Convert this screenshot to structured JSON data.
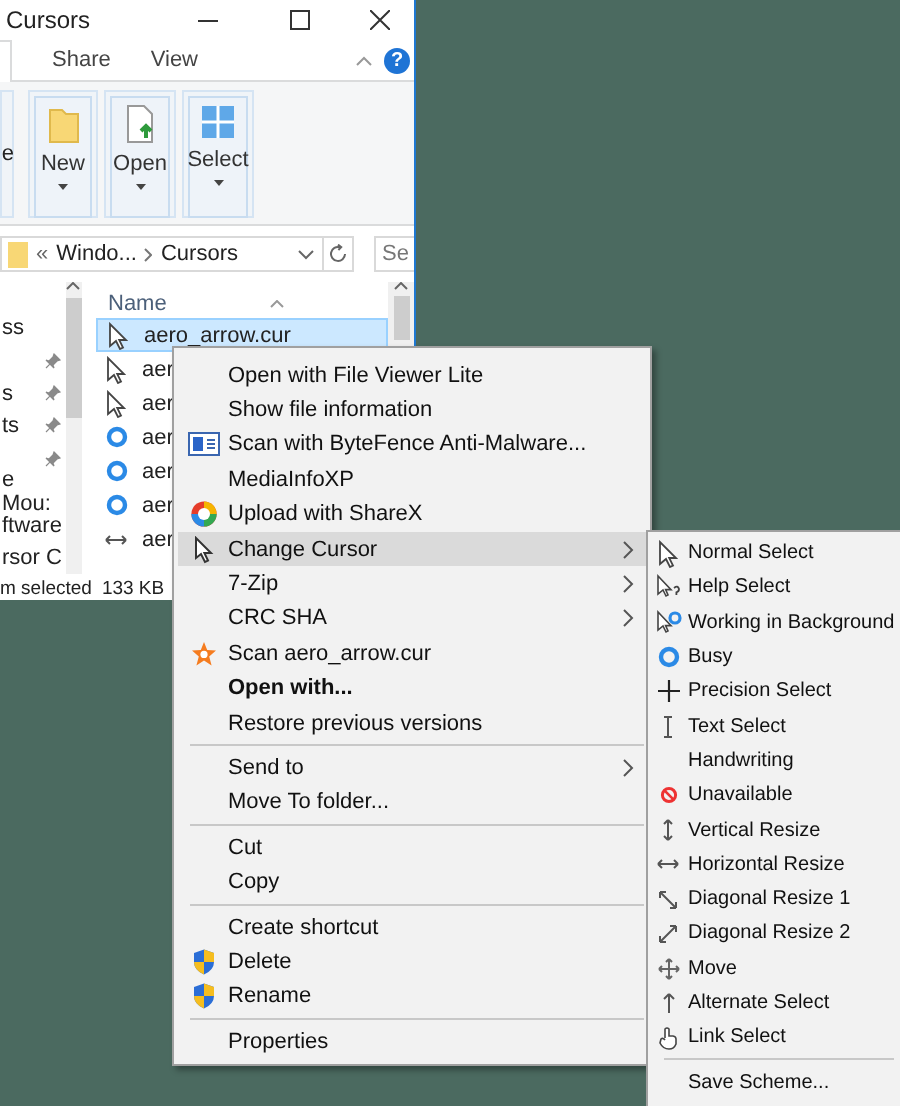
{
  "explorer": {
    "title": "Cursors",
    "ribbon_tabs": [
      "Share",
      "View"
    ],
    "help": "?",
    "ribbon_partial_label": "e",
    "ribbon_buttons": [
      "New",
      "Open",
      "Select"
    ],
    "address": {
      "overflow": "«",
      "crumbs": [
        "Windo...",
        "Cursors"
      ],
      "search_placeholder": "Se"
    },
    "nav_items": [
      {
        "label": "ss",
        "pinned": false
      },
      {
        "pinned": true
      },
      {
        "label": "s",
        "pinned": true
      },
      {
        "label": "ts",
        "pinned": true
      },
      {
        "pinned": true
      },
      {
        "label": "e Mou:",
        "pinned": false
      },
      {
        "label": "ftware",
        "pinned": false
      },
      {
        "label": "rsor C",
        "pinned": false
      }
    ],
    "column": "Name",
    "files": [
      {
        "name": "aero_arrow.cur",
        "selected": true
      },
      {
        "name": "aer",
        "selected": false
      },
      {
        "name": "aer",
        "selected": false
      },
      {
        "name": "aer",
        "selected": false
      },
      {
        "name": "aer",
        "selected": false
      },
      {
        "name": "aer",
        "selected": false
      },
      {
        "name": "aer",
        "selected": false
      }
    ],
    "status": [
      "m selected",
      "133 KB"
    ]
  },
  "context_menu": {
    "items": [
      {
        "kind": "item",
        "label": "Open with File Viewer Lite",
        "selected": false,
        "default": false,
        "submenu": false
      },
      {
        "kind": "item",
        "label": "Show file information",
        "selected": false,
        "default": false,
        "submenu": false
      },
      {
        "kind": "item",
        "label": "Scan with ByteFence Anti-Malware...",
        "selected": false,
        "default": false,
        "submenu": false
      },
      {
        "kind": "item",
        "label": "MediaInfoXP",
        "selected": false,
        "default": false,
        "submenu": false
      },
      {
        "kind": "item",
        "label": "Upload with ShareX",
        "selected": false,
        "default": false,
        "submenu": false
      },
      {
        "kind": "item",
        "label": "Change Cursor",
        "selected": true,
        "default": false,
        "submenu": true
      },
      {
        "kind": "item",
        "label": "7-Zip",
        "selected": false,
        "default": false,
        "submenu": true
      },
      {
        "kind": "item",
        "label": "CRC SHA",
        "selected": false,
        "default": false,
        "submenu": true
      },
      {
        "kind": "item",
        "label": "Scan aero_arrow.cur",
        "selected": false,
        "default": false,
        "submenu": false
      },
      {
        "kind": "item",
        "label": "Open with...",
        "selected": false,
        "default": true,
        "submenu": false
      },
      {
        "kind": "item",
        "label": "Restore previous versions",
        "selected": false,
        "default": false,
        "submenu": false
      },
      {
        "kind": "separator"
      },
      {
        "kind": "item",
        "label": "Send to",
        "selected": false,
        "default": false,
        "submenu": true
      },
      {
        "kind": "item",
        "label": "Move To folder...",
        "selected": false,
        "default": false,
        "submenu": false
      },
      {
        "kind": "separator"
      },
      {
        "kind": "item",
        "label": "Cut",
        "selected": false,
        "default": false,
        "submenu": false
      },
      {
        "kind": "item",
        "label": "Copy",
        "selected": false,
        "default": false,
        "submenu": false
      },
      {
        "kind": "separator"
      },
      {
        "kind": "item",
        "label": "Create shortcut",
        "selected": false,
        "default": false,
        "submenu": false
      },
      {
        "kind": "item",
        "label": "Delete",
        "selected": false,
        "default": false,
        "submenu": false
      },
      {
        "kind": "item",
        "label": "Rename",
        "selected": false,
        "default": false,
        "submenu": false
      },
      {
        "kind": "separator"
      },
      {
        "kind": "item",
        "label": "Properties",
        "selected": false,
        "default": false,
        "submenu": false
      }
    ]
  },
  "cursor_menu": {
    "items": [
      {
        "kind": "item",
        "label": "Normal Select"
      },
      {
        "kind": "item",
        "label": "Help Select"
      },
      {
        "kind": "item",
        "label": "Working in Background"
      },
      {
        "kind": "item",
        "label": "Busy"
      },
      {
        "kind": "item",
        "label": "Precision Select"
      },
      {
        "kind": "item",
        "label": "Text Select"
      },
      {
        "kind": "item",
        "label": "Handwriting"
      },
      {
        "kind": "item",
        "label": "Unavailable"
      },
      {
        "kind": "item",
        "label": "Vertical Resize"
      },
      {
        "kind": "item",
        "label": "Horizontal Resize"
      },
      {
        "kind": "item",
        "label": "Diagonal Resize 1"
      },
      {
        "kind": "item",
        "label": "Diagonal Resize 2"
      },
      {
        "kind": "item",
        "label": "Move"
      },
      {
        "kind": "item",
        "label": "Alternate Select"
      },
      {
        "kind": "item",
        "label": "Link Select"
      },
      {
        "kind": "separator"
      },
      {
        "kind": "item",
        "label": "Save Scheme..."
      }
    ]
  }
}
